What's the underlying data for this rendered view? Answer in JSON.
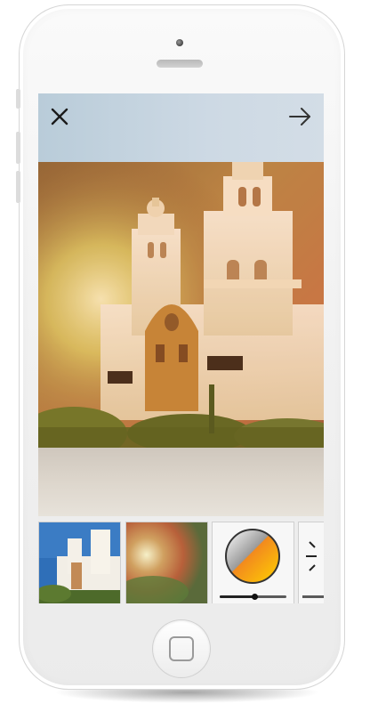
{
  "app": {
    "screen": "photo-filter-editor"
  },
  "toolbar": {
    "close_icon": "close-icon",
    "next_icon": "arrow-right-icon"
  },
  "preview": {
    "subject": "mission-church-photo-with-texture-filter"
  },
  "filter_strip": {
    "items": [
      {
        "icon": "original-photo-thumbnail"
      },
      {
        "icon": "texture-overlay-thumbnail"
      },
      {
        "icon": "color-wheel-icon",
        "slider_level": 0.52
      },
      {
        "icon": "crosshair-adjust-icon"
      }
    ]
  },
  "colors": {
    "phone_body": "#f1f1f1",
    "toolbar_bg": "#c8d6e2",
    "accent_orange": "#f28a1e",
    "accent_yellow": "#ffd200"
  }
}
